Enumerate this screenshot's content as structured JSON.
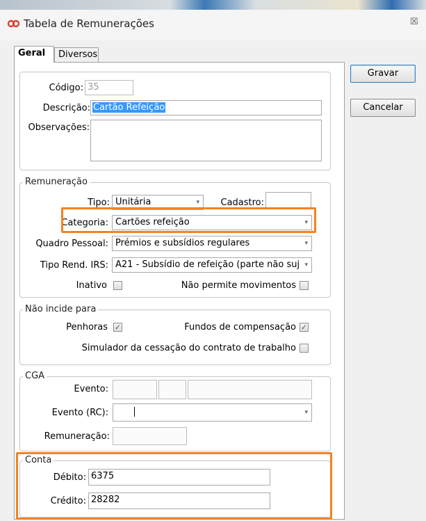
{
  "window": {
    "title": "Tabela de Remunerações",
    "close": "☒"
  },
  "tabs": [
    {
      "label": "Geral",
      "active": true
    },
    {
      "label": "Diversos",
      "active": false
    }
  ],
  "buttons": {
    "save": "Gravar",
    "cancel": "Cancelar"
  },
  "general": {
    "codigo_label": "Código:",
    "codigo_value": "35",
    "descricao_label": "Descrição:",
    "descricao_value": "Cartão Refeição",
    "observacoes_label": "Observações:",
    "observacoes_value": ""
  },
  "remuneracao": {
    "legend": "Remuneração",
    "tipo_label": "Tipo:",
    "tipo_value": "Unitária",
    "cadastro_label": "Cadastro:",
    "cadastro_value": "",
    "categoria_label": "Categoria:",
    "categoria_value": "Cartões refeição",
    "quadro_label": "Quadro Pessoal:",
    "quadro_value": "Prémios e subsídios regulares",
    "tipo_rend_label": "Tipo Rend. IRS:",
    "tipo_rend_value": "A21 - Subsídio de refeição (parte não suj",
    "inativo_label": "Inativo",
    "inativo_checked": false,
    "nao_permite_label": "Não permite movimentos",
    "nao_permite_checked": false
  },
  "nao_incide": {
    "legend": "Não incide para",
    "penhoras_label": "Penhoras",
    "penhoras_checked": true,
    "fundos_label": "Fundos de compensação",
    "fundos_checked": true,
    "simulador_label": "Simulador da cessação do contrato de trabalho",
    "simulador_checked": false
  },
  "cga": {
    "legend": "CGA",
    "evento_label": "Evento:",
    "evento_rc_label": "Evento (RC):",
    "remuneracao_label": "Remuneração:"
  },
  "conta": {
    "legend": "Conta",
    "debito_label": "Débito:",
    "debito_value": "6375",
    "credito_label": "Crédito:",
    "credito_value": "28282"
  },
  "icons": {
    "dropdown": "▾",
    "check": "✓"
  },
  "colors": {
    "highlight": "#f58221",
    "selection": "#3399ff"
  }
}
